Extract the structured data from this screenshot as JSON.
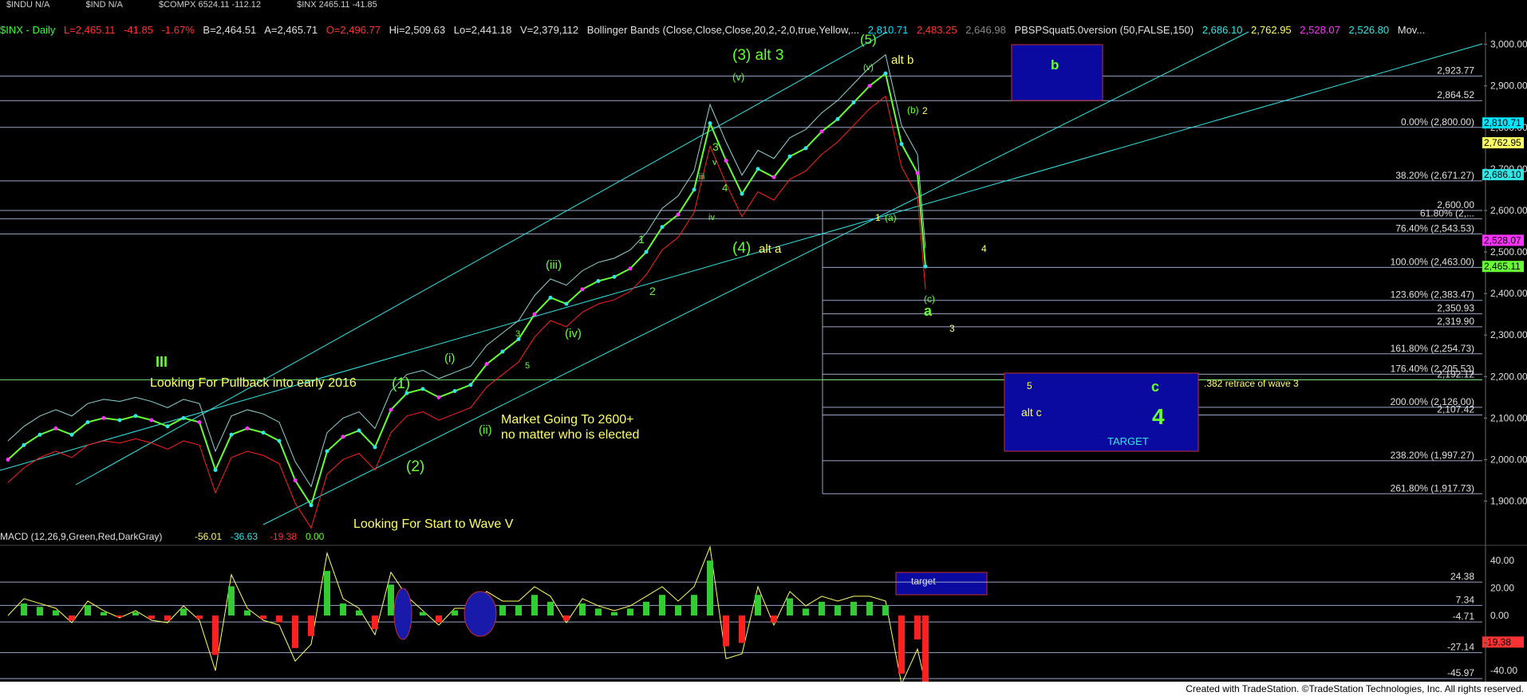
{
  "tabs": [
    "$INDU N/A",
    "$IND N/A",
    "$COMPX 6524.11 -112.12",
    "$INX 2465.11 -41.85"
  ],
  "header": {
    "symbol": "$INX - Daily",
    "last": "L=2,465.11",
    "change": "-41.85",
    "pct": "-1.67%",
    "bid": "B=2,464.51",
    "ask": "A=2,465.71",
    "open": "O=2,496.77",
    "high": "Hi=2,509.63",
    "low": "Lo=2,441.18",
    "volume": "V=2,379,112",
    "bb_label": "Bollinger Bands (Close,Close,Close,20,2,-2,0,true,Yellow,...",
    "bb_v1": "2,810.71",
    "bb_v2": "2,483.25",
    "bb_v3": "2,646.98",
    "pbs_label": "PBSPSquat5.0version (50,FALSE,150)",
    "pbs_v1": "2,686.10",
    "pbs_v2": "2,762.95",
    "pbs_v3": "2,528.07",
    "pbs_v4": "2,526.80",
    "mov": "Mov..."
  },
  "colors": {
    "green": "#33cc33",
    "lightgreen": "#66ff33",
    "yellow": "#ffff66",
    "cyan": "#33e6e6",
    "magenta": "#ff33ff",
    "red": "#ff2020",
    "blue_box": "#0000aa",
    "bb_line": "#8fd4d4",
    "fib_line": "#9aa4c8"
  },
  "chart_data": [
    {
      "type": "line",
      "title": "$INX - Daily",
      "ylim": [
        1830,
        3030
      ],
      "y_ticks": [
        "3,000.00",
        "2,900.00",
        "2,800.00",
        "2,700.00",
        "2,600.00",
        "2,500.00",
        "2,400.00",
        "2,300.00",
        "2,200.00",
        "2,100.00",
        "2,000.00",
        "1,900.00"
      ],
      "y_tick_values": [
        3000,
        2900,
        2800,
        2700,
        2600,
        2500,
        2400,
        2300,
        2200,
        2100,
        2000,
        1900
      ],
      "series": [
        {
          "name": "$INX",
          "x": [
            0,
            20,
            40,
            60,
            80,
            100,
            120,
            140,
            160,
            180,
            200,
            220,
            240,
            260,
            280,
            300,
            320,
            340,
            360,
            380,
            400,
            420,
            440,
            460,
            480,
            500,
            520,
            540,
            560,
            580,
            600,
            620,
            640,
            660,
            680,
            700,
            720,
            740,
            760,
            780,
            800,
            820,
            840,
            860,
            880,
            900,
            920,
            940,
            960,
            980,
            1000,
            1020,
            1040,
            1060,
            1080,
            1100,
            1120,
            1140,
            1150
          ],
          "values": [
            2000,
            2035,
            2060,
            2075,
            2060,
            2090,
            2100,
            2095,
            2105,
            2095,
            2080,
            2100,
            2090,
            1975,
            2060,
            2075,
            2065,
            2045,
            1950,
            1890,
            2020,
            2055,
            2070,
            2030,
            2120,
            2160,
            2170,
            2150,
            2165,
            2180,
            2230,
            2260,
            2290,
            2350,
            2390,
            2375,
            2410,
            2430,
            2440,
            2460,
            2500,
            2560,
            2590,
            2650,
            2810,
            2720,
            2640,
            2700,
            2680,
            2730,
            2750,
            2790,
            2820,
            2860,
            2900,
            2930,
            2760,
            2690,
            2465
          ]
        }
      ],
      "horizontal_levels": [
        {
          "value": 2923.77,
          "label": "2,923.77"
        },
        {
          "value": 2864.52,
          "label": "2,864.52"
        },
        {
          "value": 2800.0,
          "label": "0.00% (2,800.00)"
        },
        {
          "value": 2671.27,
          "label": "38.20% (2,671.27)"
        },
        {
          "value": 2600.0,
          "label": "2,600.00"
        },
        {
          "value": 2580.0,
          "label": "61.80% (2,..."
        },
        {
          "value": 2543.53,
          "label": "76.40% (2,543.53)"
        },
        {
          "value": 2463.0,
          "label": "100.00% (2,463.00)"
        },
        {
          "value": 2383.47,
          "label": "123.60% (2,383.47)"
        },
        {
          "value": 2350.93,
          "label": "2,350.93"
        },
        {
          "value": 2319.9,
          "label": "2,319.90"
        },
        {
          "value": 2254.73,
          "label": "161.80% (2,254.73)"
        },
        {
          "value": 2205.53,
          "label": "176.40% (2,205.53)"
        },
        {
          "value": 2192.12,
          "label": "2,192.12"
        },
        {
          "value": 2126.0,
          "label": "200.00% (2,126.00)"
        },
        {
          "value": 2107.42,
          "label": "2,107.42"
        },
        {
          "value": 1997.27,
          "label": "238.20% (1,997.27)"
        },
        {
          "value": 1917.73,
          "label": "261.80% (1,917.73)"
        }
      ],
      "price_tags": [
        {
          "value": 2810.71,
          "label": "2,810.71",
          "color": "#00e5ff"
        },
        {
          "value": 2762.95,
          "label": "2,762.95",
          "color": "#ffff66"
        },
        {
          "value": 2686.1,
          "label": "2,686.10",
          "color": "#33e6e6"
        },
        {
          "value": 2528.07,
          "label": "2,528.07",
          "color": "#ff33ff"
        },
        {
          "value": 2465.11,
          "label": "2,465.11",
          "color": "#66ff33"
        }
      ]
    },
    {
      "type": "line",
      "title": "MACD (12,26,9,Green,Red,DarkGray)",
      "values_label": [
        "-56.01",
        "-36.63",
        "-19.38",
        "0.00"
      ],
      "ylim": [
        -50,
        50
      ],
      "y_ticks": [
        "40.00",
        "20.00",
        "0.00",
        "-20.00",
        "-40.00"
      ],
      "y_tick_values": [
        40,
        20,
        0,
        -20,
        -40
      ],
      "levels": [
        {
          "value": 24.38,
          "label": "24.38"
        },
        {
          "value": 7.34,
          "label": "7.34"
        },
        {
          "value": -4.71,
          "label": "-4.71"
        },
        {
          "value": -27.14,
          "label": "-27.14"
        },
        {
          "value": -45.97,
          "label": "-45.97"
        }
      ],
      "last_tag": {
        "value": -19.38,
        "label": "-19.38"
      }
    }
  ],
  "annotations": {
    "w3alt": "(3) alt 3",
    "w5": "(5)",
    "altb": "alt b",
    "b_box": "b",
    "w4alt": "(4)",
    "alta": "alt a",
    "v1": "(v)",
    "v2": "(v)",
    "b2": "(b)",
    "n2": "2",
    "n1": "1",
    "a_paren": "(a)",
    "four": "4",
    "c_paren": "(c)",
    "a_letter": "a",
    "three": "3",
    "iii": "(iii)",
    "iv": "(iv)",
    "one_big": "(1)",
    "two_big": "(2)",
    "i_paren": "(i)",
    "ii_paren": "(ii)",
    "roman3": "III",
    "pullback": "Looking For Pullback into early 2016",
    "market_line1": "Market Going To 2600+",
    "market_line2": "no matter who is elected",
    "start_wave": "Looking For Start to Wave V",
    "box_five": "5",
    "box_c": "c",
    "box_altc": "alt c",
    "box_four": "4",
    "box_target": "TARGET",
    "retrace": ".382 retrace of wave 3",
    "macd_target": "target",
    "small_3": "3",
    "small_5": "5",
    "small_iii": "iii",
    "small_v": "v",
    "small_4": "4",
    "small_iv": "iv",
    "small_1": "1",
    "small_2": "2"
  },
  "footer": "Created with TradeStation. ©TradeStation Technologies, Inc. All rights reserved."
}
